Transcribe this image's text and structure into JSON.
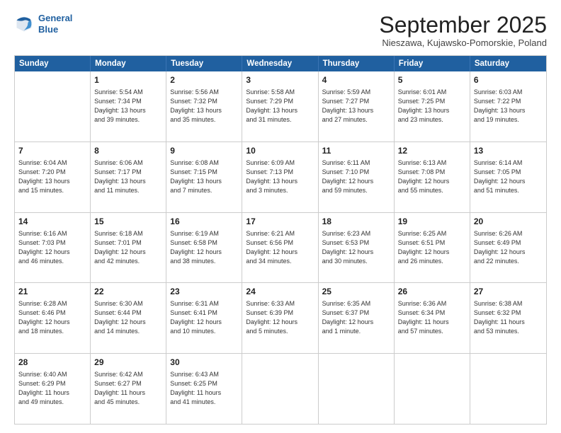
{
  "logo": {
    "line1": "General",
    "line2": "Blue"
  },
  "title": "September 2025",
  "subtitle": "Nieszawa, Kujawsko-Pomorskie, Poland",
  "header_days": [
    "Sunday",
    "Monday",
    "Tuesday",
    "Wednesday",
    "Thursday",
    "Friday",
    "Saturday"
  ],
  "weeks": [
    [
      {
        "day": "",
        "text": ""
      },
      {
        "day": "1",
        "text": "Sunrise: 5:54 AM\nSunset: 7:34 PM\nDaylight: 13 hours\nand 39 minutes."
      },
      {
        "day": "2",
        "text": "Sunrise: 5:56 AM\nSunset: 7:32 PM\nDaylight: 13 hours\nand 35 minutes."
      },
      {
        "day": "3",
        "text": "Sunrise: 5:58 AM\nSunset: 7:29 PM\nDaylight: 13 hours\nand 31 minutes."
      },
      {
        "day": "4",
        "text": "Sunrise: 5:59 AM\nSunset: 7:27 PM\nDaylight: 13 hours\nand 27 minutes."
      },
      {
        "day": "5",
        "text": "Sunrise: 6:01 AM\nSunset: 7:25 PM\nDaylight: 13 hours\nand 23 minutes."
      },
      {
        "day": "6",
        "text": "Sunrise: 6:03 AM\nSunset: 7:22 PM\nDaylight: 13 hours\nand 19 minutes."
      }
    ],
    [
      {
        "day": "7",
        "text": "Sunrise: 6:04 AM\nSunset: 7:20 PM\nDaylight: 13 hours\nand 15 minutes."
      },
      {
        "day": "8",
        "text": "Sunrise: 6:06 AM\nSunset: 7:17 PM\nDaylight: 13 hours\nand 11 minutes."
      },
      {
        "day": "9",
        "text": "Sunrise: 6:08 AM\nSunset: 7:15 PM\nDaylight: 13 hours\nand 7 minutes."
      },
      {
        "day": "10",
        "text": "Sunrise: 6:09 AM\nSunset: 7:13 PM\nDaylight: 13 hours\nand 3 minutes."
      },
      {
        "day": "11",
        "text": "Sunrise: 6:11 AM\nSunset: 7:10 PM\nDaylight: 12 hours\nand 59 minutes."
      },
      {
        "day": "12",
        "text": "Sunrise: 6:13 AM\nSunset: 7:08 PM\nDaylight: 12 hours\nand 55 minutes."
      },
      {
        "day": "13",
        "text": "Sunrise: 6:14 AM\nSunset: 7:05 PM\nDaylight: 12 hours\nand 51 minutes."
      }
    ],
    [
      {
        "day": "14",
        "text": "Sunrise: 6:16 AM\nSunset: 7:03 PM\nDaylight: 12 hours\nand 46 minutes."
      },
      {
        "day": "15",
        "text": "Sunrise: 6:18 AM\nSunset: 7:01 PM\nDaylight: 12 hours\nand 42 minutes."
      },
      {
        "day": "16",
        "text": "Sunrise: 6:19 AM\nSunset: 6:58 PM\nDaylight: 12 hours\nand 38 minutes."
      },
      {
        "day": "17",
        "text": "Sunrise: 6:21 AM\nSunset: 6:56 PM\nDaylight: 12 hours\nand 34 minutes."
      },
      {
        "day": "18",
        "text": "Sunrise: 6:23 AM\nSunset: 6:53 PM\nDaylight: 12 hours\nand 30 minutes."
      },
      {
        "day": "19",
        "text": "Sunrise: 6:25 AM\nSunset: 6:51 PM\nDaylight: 12 hours\nand 26 minutes."
      },
      {
        "day": "20",
        "text": "Sunrise: 6:26 AM\nSunset: 6:49 PM\nDaylight: 12 hours\nand 22 minutes."
      }
    ],
    [
      {
        "day": "21",
        "text": "Sunrise: 6:28 AM\nSunset: 6:46 PM\nDaylight: 12 hours\nand 18 minutes."
      },
      {
        "day": "22",
        "text": "Sunrise: 6:30 AM\nSunset: 6:44 PM\nDaylight: 12 hours\nand 14 minutes."
      },
      {
        "day": "23",
        "text": "Sunrise: 6:31 AM\nSunset: 6:41 PM\nDaylight: 12 hours\nand 10 minutes."
      },
      {
        "day": "24",
        "text": "Sunrise: 6:33 AM\nSunset: 6:39 PM\nDaylight: 12 hours\nand 5 minutes."
      },
      {
        "day": "25",
        "text": "Sunrise: 6:35 AM\nSunset: 6:37 PM\nDaylight: 12 hours\nand 1 minute."
      },
      {
        "day": "26",
        "text": "Sunrise: 6:36 AM\nSunset: 6:34 PM\nDaylight: 11 hours\nand 57 minutes."
      },
      {
        "day": "27",
        "text": "Sunrise: 6:38 AM\nSunset: 6:32 PM\nDaylight: 11 hours\nand 53 minutes."
      }
    ],
    [
      {
        "day": "28",
        "text": "Sunrise: 6:40 AM\nSunset: 6:29 PM\nDaylight: 11 hours\nand 49 minutes."
      },
      {
        "day": "29",
        "text": "Sunrise: 6:42 AM\nSunset: 6:27 PM\nDaylight: 11 hours\nand 45 minutes."
      },
      {
        "day": "30",
        "text": "Sunrise: 6:43 AM\nSunset: 6:25 PM\nDaylight: 11 hours\nand 41 minutes."
      },
      {
        "day": "",
        "text": ""
      },
      {
        "day": "",
        "text": ""
      },
      {
        "day": "",
        "text": ""
      },
      {
        "day": "",
        "text": ""
      }
    ]
  ]
}
